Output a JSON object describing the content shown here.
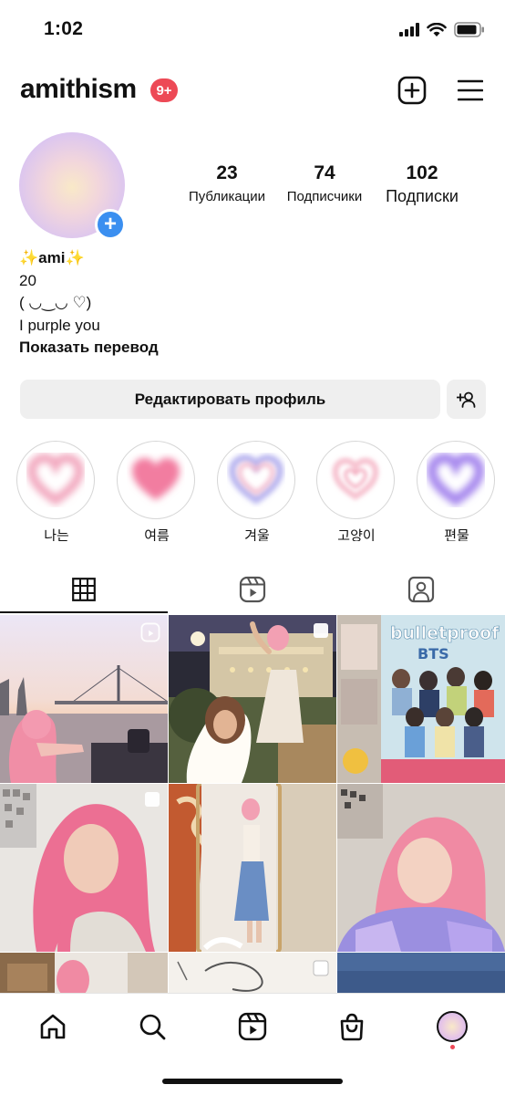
{
  "status_bar": {
    "time": "1:02"
  },
  "header": {
    "username": "amithism",
    "notifications_badge": "9+"
  },
  "profile": {
    "stats": [
      {
        "value": "23",
        "label": "Публикации"
      },
      {
        "value": "74",
        "label": "Подписчики"
      },
      {
        "value": "102",
        "label": "Подписки"
      }
    ],
    "bio": {
      "name": "✨ami✨",
      "lines": [
        "20",
        "( ◡‿◡ ♡)",
        "I purple you"
      ],
      "translate_label": "Показать перевод"
    }
  },
  "actions": {
    "edit_profile_label": "Редактировать профиль"
  },
  "highlights": [
    {
      "label": "나는",
      "color": "#f2a9bf"
    },
    {
      "label": "여름",
      "color": "#f27da0"
    },
    {
      "label": "겨울",
      "color": "#b9b6f0"
    },
    {
      "label": "고양이",
      "color": "#f7c4d1"
    },
    {
      "label": "편물",
      "color": "#a789ee"
    }
  ],
  "tabs": [
    {
      "name": "grid-icon",
      "active": true
    },
    {
      "name": "reels-icon",
      "active": false
    },
    {
      "name": "tagged-icon",
      "active": false
    }
  ],
  "colors": {
    "accent_blue": "#3b8ff0",
    "badge_red": "#ed4956",
    "button_bg": "#efefef"
  }
}
